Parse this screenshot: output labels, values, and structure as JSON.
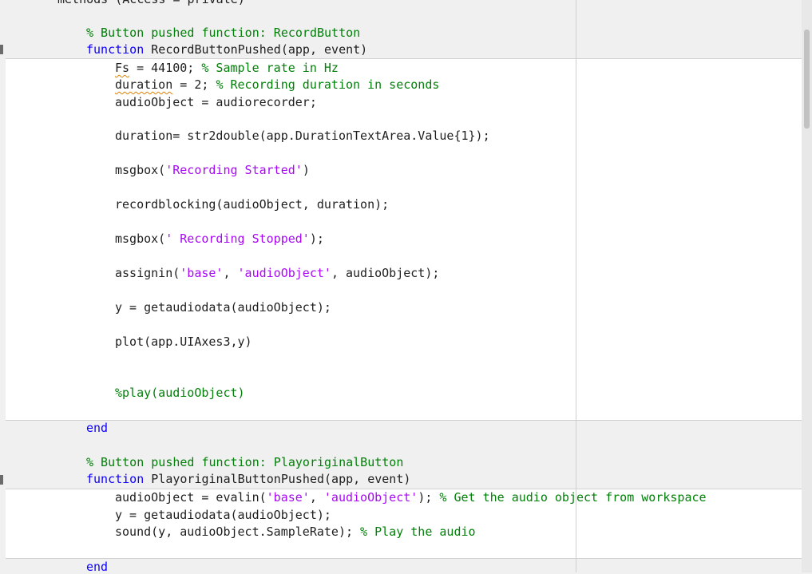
{
  "editor": {
    "lines": {
      "l0": [
        {
          "t": "methods (Access = private)",
          "c": "pl"
        }
      ],
      "l1": [
        {
          "t": "% Button pushed function: RecordButton",
          "c": "cm"
        }
      ],
      "l2": [
        {
          "t": "function",
          "c": "kw"
        },
        {
          "t": " RecordButtonPushed(app, event)",
          "c": "pl"
        }
      ],
      "l3": [
        {
          "t": "Fs",
          "c": "pl",
          "u": true
        },
        {
          "t": " = 44100; ",
          "c": "pl"
        },
        {
          "t": "% Sample rate in Hz",
          "c": "cm"
        }
      ],
      "l4": [
        {
          "t": "duration",
          "c": "pl",
          "u": true
        },
        {
          "t": " = 2; ",
          "c": "pl"
        },
        {
          "t": "% Recording duration in seconds",
          "c": "cm"
        }
      ],
      "l5": [
        {
          "t": "audioObject = audiorecorder;",
          "c": "pl"
        }
      ],
      "l6": [
        {
          "t": "duration= str2double(app.DurationTextArea.Value{1});",
          "c": "pl"
        }
      ],
      "l7": [
        {
          "t": "msgbox(",
          "c": "pl"
        },
        {
          "t": "'Recording Started'",
          "c": "str"
        },
        {
          "t": ")",
          "c": "pl"
        }
      ],
      "l8": [
        {
          "t": "recordblocking(audioObject, duration);",
          "c": "pl"
        }
      ],
      "l9": [
        {
          "t": "msgbox(",
          "c": "pl"
        },
        {
          "t": "' Recording Stopped'",
          "c": "str"
        },
        {
          "t": ");",
          "c": "pl"
        }
      ],
      "l10": [
        {
          "t": "assignin(",
          "c": "pl"
        },
        {
          "t": "'base'",
          "c": "str"
        },
        {
          "t": ", ",
          "c": "pl"
        },
        {
          "t": "'audioObject'",
          "c": "str"
        },
        {
          "t": ", audioObject);",
          "c": "pl"
        }
      ],
      "l11": [
        {
          "t": "y = getaudiodata(audioObject);",
          "c": "pl"
        }
      ],
      "l12": [
        {
          "t": "plot(app.UIAxes3,y)",
          "c": "pl"
        }
      ],
      "l13": [
        {
          "t": "%play(audioObject)",
          "c": "cm"
        }
      ],
      "l14": [
        {
          "t": "end",
          "c": "kw"
        }
      ],
      "l15": [
        {
          "t": "% Button pushed function: PlayoriginalButton",
          "c": "cm"
        }
      ],
      "l16": [
        {
          "t": "function",
          "c": "kw"
        },
        {
          "t": " PlayoriginalButtonPushed(app, event)",
          "c": "pl"
        }
      ],
      "l17": [
        {
          "t": "audioObject = evalin(",
          "c": "pl"
        },
        {
          "t": "'base'",
          "c": "str"
        },
        {
          "t": ", ",
          "c": "pl"
        },
        {
          "t": "'audioObject'",
          "c": "str"
        },
        {
          "t": "); ",
          "c": "pl"
        },
        {
          "t": "% Get the audio object from workspace",
          "c": "cm"
        }
      ],
      "l18": [
        {
          "t": "y = getaudiodata(audioObject);",
          "c": "pl"
        }
      ],
      "l19": [
        {
          "t": "sound(y, audioObject.SampleRate); ",
          "c": "pl"
        },
        {
          "t": "% Play the audio",
          "c": "cm"
        }
      ],
      "l20": [
        {
          "t": "end",
          "c": "kw"
        }
      ]
    }
  }
}
